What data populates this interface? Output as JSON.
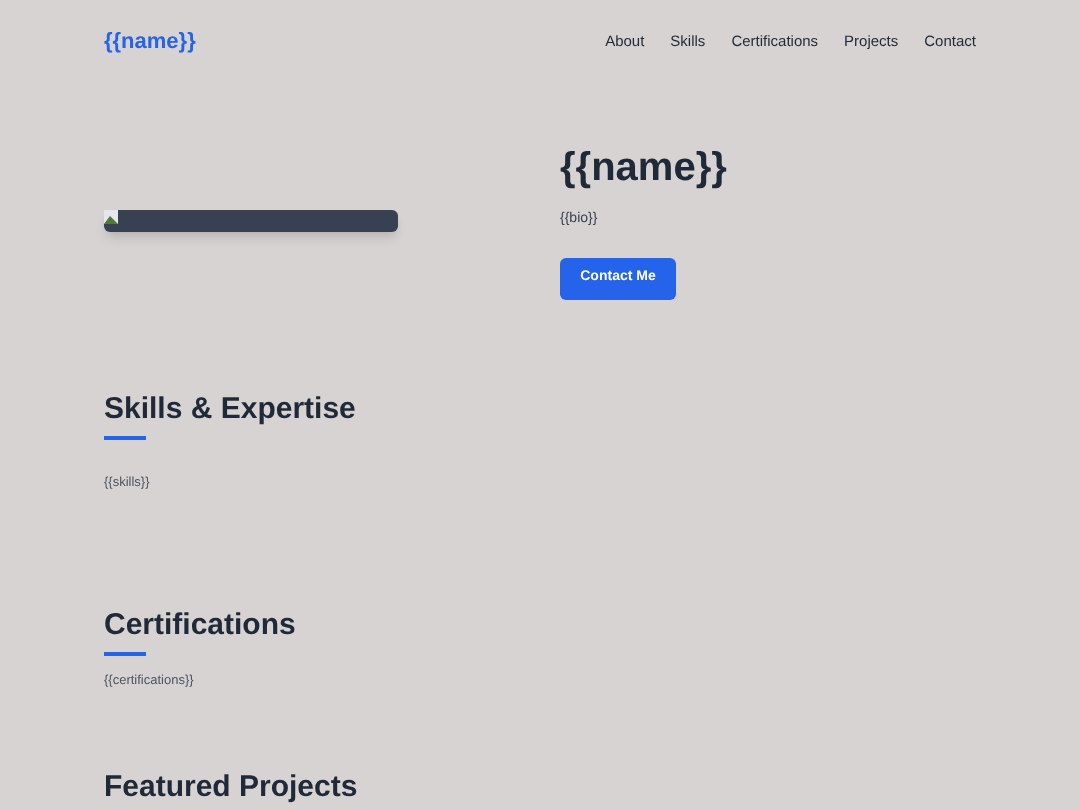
{
  "header": {
    "logo": "{{name}}",
    "nav": [
      "About",
      "Skills",
      "Certifications",
      "Projects",
      "Contact"
    ]
  },
  "hero": {
    "image": {
      "kind": "broken-image"
    },
    "name": "{{name}}",
    "bio": "{{bio}}",
    "button": "Contact Me"
  },
  "sections": [
    {
      "title": "Skills & Expertise",
      "body": "{{skills}}"
    },
    {
      "title": "Certifications",
      "body": "{{certifications}}"
    },
    {
      "title": "Featured Projects"
    }
  ]
}
